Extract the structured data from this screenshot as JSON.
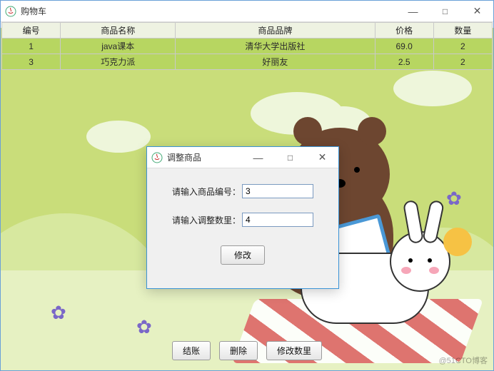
{
  "main_window": {
    "title": "购物车",
    "buttons": {
      "minimize": "—",
      "maximize": "□",
      "close": "✕"
    }
  },
  "table": {
    "headers": [
      "编号",
      "商品名称",
      "商品品牌",
      "价格",
      "数量"
    ],
    "rows": [
      {
        "id": "1",
        "name": "java课本",
        "brand": "清华大学出版社",
        "price": "69.0",
        "qty": "2"
      },
      {
        "id": "3",
        "name": "巧克力派",
        "brand": "好丽友",
        "price": "2.5",
        "qty": "2"
      }
    ]
  },
  "bottom_buttons": {
    "checkout": "结账",
    "delete": "删除",
    "modify_qty": "修改数里"
  },
  "dialog": {
    "title": "调整商品",
    "buttons": {
      "minimize": "—",
      "maximize": "□",
      "close": "✕"
    },
    "field_id_label": "请输入商品编号：",
    "field_id_value": "3",
    "field_qty_label": "请输入调整数里：",
    "field_qty_value": "4",
    "submit": "修改"
  },
  "watermark": "@51CTO博客"
}
